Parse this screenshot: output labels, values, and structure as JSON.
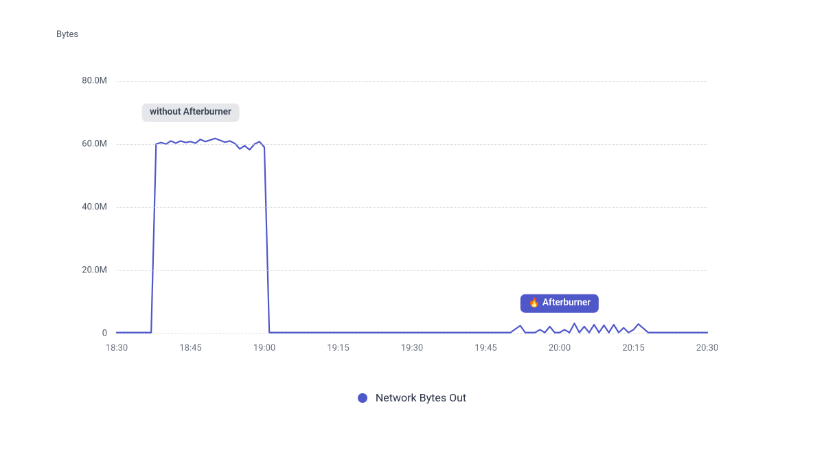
{
  "chart_data": {
    "type": "line",
    "title": "",
    "xlabel": "",
    "ylabel": "Bytes",
    "ylim": [
      0,
      80000000
    ],
    "x_ticks": [
      "18:30",
      "18:45",
      "19:00",
      "19:15",
      "19:30",
      "19:45",
      "20:00",
      "20:15",
      "20:30"
    ],
    "y_ticks": [
      "0",
      "20.0M",
      "40.0M",
      "60.0M",
      "80.0M"
    ],
    "series": [
      {
        "name": "Network Bytes Out",
        "color": "#4f58c9",
        "x_minutes_from_1830": [
          0,
          2,
          4,
          6,
          7,
          8,
          9,
          10,
          11,
          12,
          13,
          14,
          15,
          16,
          17,
          18,
          19,
          20,
          21,
          22,
          23,
          24,
          25,
          26,
          27,
          28,
          29,
          30,
          31,
          33,
          35,
          37,
          40,
          45,
          50,
          55,
          60,
          65,
          70,
          72,
          74,
          76,
          78,
          80,
          82,
          83,
          84,
          85,
          86,
          87,
          88,
          89,
          90,
          91,
          92,
          93,
          94,
          95,
          96,
          97,
          98,
          99,
          100,
          101,
          102,
          103,
          104,
          105,
          106,
          108,
          110,
          112,
          115,
          118,
          120
        ],
        "values_millions": [
          0.3,
          0.3,
          0.3,
          0.3,
          0.3,
          60,
          60.5,
          60,
          61,
          60.3,
          61,
          60.5,
          60.8,
          60.3,
          61.5,
          60.8,
          61.3,
          61.8,
          61.2,
          60.6,
          61,
          60.2,
          58.5,
          59.5,
          58.2,
          60,
          60.8,
          59,
          0.3,
          0.3,
          0.3,
          0.3,
          0.3,
          0.3,
          0.3,
          0.3,
          0.3,
          0.3,
          0.3,
          0.3,
          0.3,
          0.3,
          0.3,
          0.3,
          2.5,
          0.3,
          0.3,
          0.3,
          1.2,
          0.3,
          2.2,
          0.3,
          0.3,
          1.2,
          0.3,
          3.2,
          0.3,
          2.2,
          0.3,
          2.8,
          0.3,
          2.6,
          0.3,
          2.8,
          0.3,
          1.8,
          0.3,
          1.2,
          3,
          0.3,
          0.3,
          0.3,
          0.3,
          0.3,
          0.3
        ]
      }
    ],
    "annotations": [
      {
        "label": "without Afterburner",
        "style": "grey",
        "anchor_minute": 15,
        "y_millions": 70
      },
      {
        "label": "🔥 Afterburner",
        "style": "blue",
        "anchor_minute": 90,
        "y_millions": 9.5
      }
    ],
    "legend": [
      {
        "label": "Network Bytes Out",
        "color": "#4f58c9"
      }
    ]
  }
}
